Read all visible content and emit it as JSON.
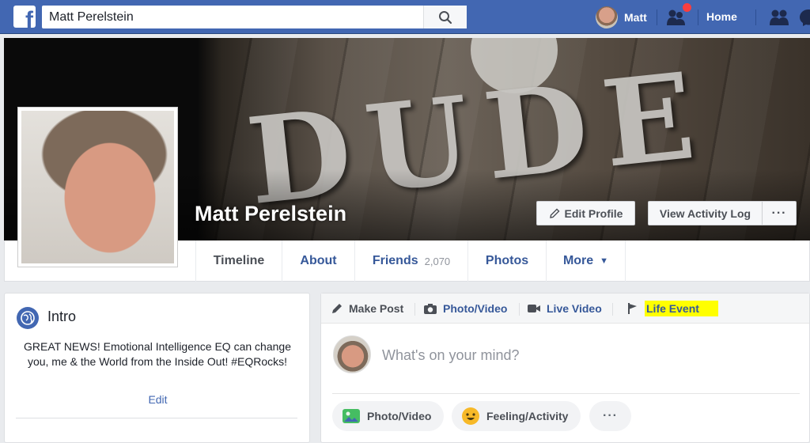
{
  "topbar": {
    "search_value": "Matt Perelstein",
    "user_name": "Matt",
    "home_label": "Home",
    "notification_color": "#fa3e3e",
    "brand_color": "#4267b2"
  },
  "cover": {
    "text": "DUDE"
  },
  "profile": {
    "name": "Matt Perelstein",
    "edit_profile_label": "Edit Profile",
    "activity_log_label": "View Activity Log",
    "more_label": "···"
  },
  "tabs": {
    "timeline": "Timeline",
    "about": "About",
    "friends": "Friends",
    "friends_count": "2,070",
    "photos": "Photos",
    "more": "More",
    "more_caret": "▼"
  },
  "intro": {
    "title": "Intro",
    "bio": "GREAT NEWS! Emotional Intelligence EQ can change you, me & the World from the Inside Out! #EQRocks!",
    "edit_label": "Edit"
  },
  "composer": {
    "make_post": "Make Post",
    "photo_video": "Photo/Video",
    "live_video": "Live Video",
    "life_event": "Life Event",
    "placeholder": "What's on your mind?",
    "pill_photo": "Photo/Video",
    "pill_feeling": "Feeling/Activity",
    "pill_more": "···"
  }
}
